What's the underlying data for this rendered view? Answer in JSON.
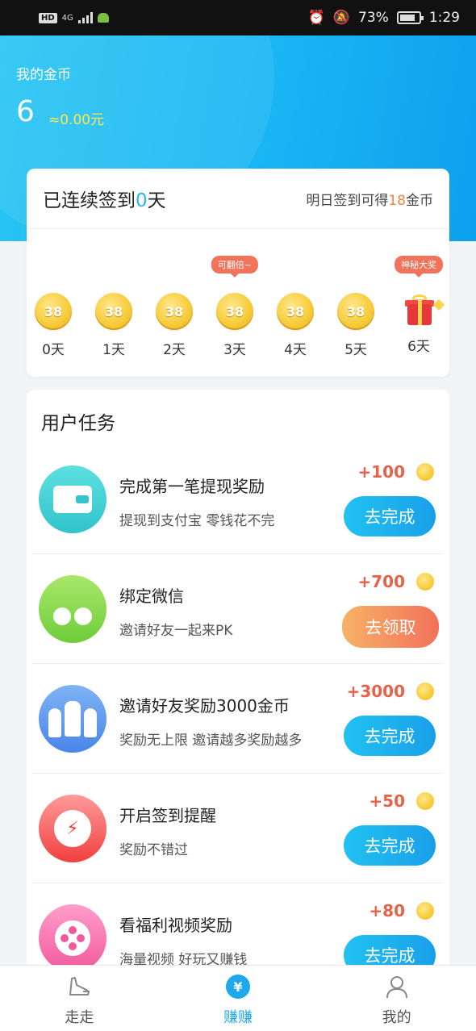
{
  "status_bar": {
    "network_badge": "HD",
    "signal_type": "4G",
    "battery_percent": "73%",
    "time": "1:29"
  },
  "header": {
    "coin_label": "我的金币",
    "coin_amount": "6",
    "coin_value": "≈0.00元"
  },
  "checkin": {
    "title_prefix": "已连续签到",
    "streak_days": "0",
    "title_suffix": "天",
    "tomorrow_prefix": "明日签到可得",
    "tomorrow_coins": "18",
    "tomorrow_suffix": "金币",
    "days": [
      {
        "coin": "38",
        "label": "0天"
      },
      {
        "coin": "38",
        "label": "1天"
      },
      {
        "coin": "38",
        "label": "2天"
      },
      {
        "coin": "38",
        "label": "3天",
        "tag": "可翻倍~"
      },
      {
        "coin": "38",
        "label": "4天"
      },
      {
        "coin": "38",
        "label": "5天"
      },
      {
        "label": "6天",
        "tag": "神秘大奖"
      }
    ]
  },
  "tasks": {
    "heading": "用户任务",
    "items": [
      {
        "title": "完成第一笔提现奖励",
        "desc": "提现到支付宝 零钱花不完",
        "reward": "+100",
        "button": "去完成",
        "icon": "wallet-icon"
      },
      {
        "title": "绑定微信",
        "desc": "邀请好友一起来PK",
        "reward": "+700",
        "button": "去领取",
        "icon": "cherry-icon"
      },
      {
        "title": "邀请好友奖励3000金币",
        "desc": "奖励无上限 邀请越多奖励越多",
        "reward": "+3000",
        "button": "去完成",
        "icon": "people-icon"
      },
      {
        "title": "开启签到提醒",
        "desc": "奖励不错过",
        "reward": "+50",
        "button": "去完成",
        "icon": "alarm-icon"
      },
      {
        "title": "看福利视频奖励",
        "desc": "海量视频 好玩又赚钱",
        "reward": "+80",
        "button": "去完成",
        "icon": "video-icon"
      }
    ]
  },
  "bottom_nav": {
    "items": [
      {
        "label": "走走",
        "icon": "shoe-icon"
      },
      {
        "label": "赚赚",
        "icon": "yen-icon",
        "active": true
      },
      {
        "label": "我的",
        "icon": "user-icon"
      }
    ],
    "yen_symbol": "¥"
  },
  "colors": {
    "accent_blue": "#1fa8ee",
    "reward_orange": "#e8624a",
    "coin_value_yellow": "#ffe94a"
  }
}
